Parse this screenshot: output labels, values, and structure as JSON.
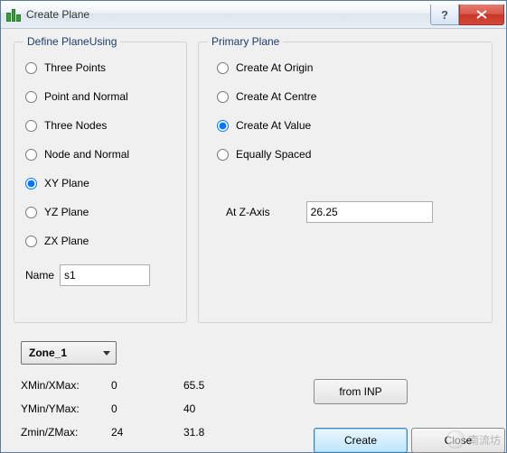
{
  "window": {
    "title": "Create Plane"
  },
  "define": {
    "legend": "Define PlaneUsing",
    "options": [
      "Three Points",
      "Point and Normal",
      "Three Nodes",
      "Node and Normal",
      "XY Plane",
      "YZ Plane",
      "ZX Plane"
    ],
    "selected_index": 4,
    "name_label": "Name",
    "name_value": "s1"
  },
  "primary": {
    "legend": "Primary Plane",
    "options": [
      "Create At Origin",
      "Create At Centre",
      "Create At Value",
      "Equally Spaced"
    ],
    "selected_index": 2,
    "axis_label": "At Z-Axis",
    "axis_value": "26.25"
  },
  "zone": {
    "selected": "Zone_1"
  },
  "ranges": {
    "rows": [
      {
        "label": "XMin/XMax:",
        "min": "0",
        "max": "65.5"
      },
      {
        "label": "YMin/YMax:",
        "min": "0",
        "max": "40"
      },
      {
        "label": "Zmin/ZMax:",
        "min": "24",
        "max": "31.8"
      }
    ]
  },
  "buttons": {
    "from_inp": "from INP",
    "create": "Create",
    "close": "Close"
  },
  "watermark": "南流坊"
}
